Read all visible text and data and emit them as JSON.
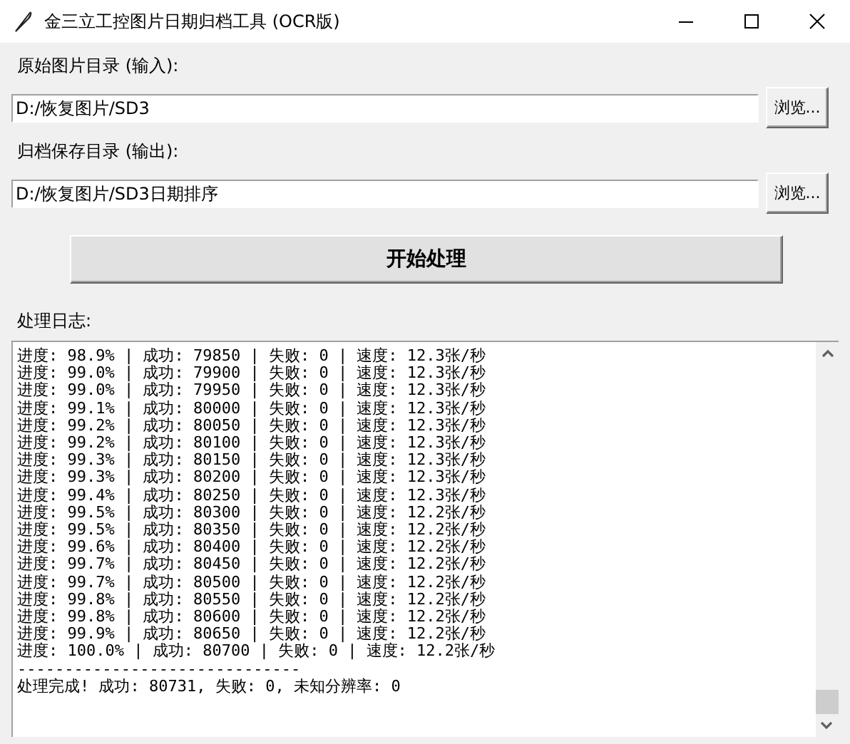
{
  "window": {
    "title": "金三立工控图片日期归档工具 (OCR版)"
  },
  "inputs": [
    {
      "label": "原始图片目录 (输入):",
      "value": "D:/恢复图片/SD3",
      "button": "浏览..."
    },
    {
      "label": "归档保存目录 (输出):",
      "value": "D:/恢复图片/SD3日期排序",
      "button": "浏览..."
    }
  ],
  "start_button": "开始处理",
  "log": {
    "label": "处理日志:",
    "lines": [
      "进度: 98.9% | 成功: 79850 | 失败: 0 | 速度: 12.3张/秒",
      "进度: 99.0% | 成功: 79900 | 失败: 0 | 速度: 12.3张/秒",
      "进度: 99.0% | 成功: 79950 | 失败: 0 | 速度: 12.3张/秒",
      "进度: 99.1% | 成功: 80000 | 失败: 0 | 速度: 12.3张/秒",
      "进度: 99.2% | 成功: 80050 | 失败: 0 | 速度: 12.3张/秒",
      "进度: 99.2% | 成功: 80100 | 失败: 0 | 速度: 12.3张/秒",
      "进度: 99.3% | 成功: 80150 | 失败: 0 | 速度: 12.3张/秒",
      "进度: 99.3% | 成功: 80200 | 失败: 0 | 速度: 12.3张/秒",
      "进度: 99.4% | 成功: 80250 | 失败: 0 | 速度: 12.3张/秒",
      "进度: 99.5% | 成功: 80300 | 失败: 0 | 速度: 12.2张/秒",
      "进度: 99.5% | 成功: 80350 | 失败: 0 | 速度: 12.2张/秒",
      "进度: 99.6% | 成功: 80400 | 失败: 0 | 速度: 12.2张/秒",
      "进度: 99.7% | 成功: 80450 | 失败: 0 | 速度: 12.2张/秒",
      "进度: 99.7% | 成功: 80500 | 失败: 0 | 速度: 12.2张/秒",
      "进度: 99.8% | 成功: 80550 | 失败: 0 | 速度: 12.2张/秒",
      "进度: 99.8% | 成功: 80600 | 失败: 0 | 速度: 12.2张/秒",
      "进度: 99.9% | 成功: 80650 | 失败: 0 | 速度: 12.2张/秒",
      "进度: 100.0% | 成功: 80700 | 失败: 0 | 速度: 12.2张/秒",
      "------------------------------",
      "处理完成! 成功: 80731, 失败: 0, 未知分辨率: 0"
    ]
  }
}
